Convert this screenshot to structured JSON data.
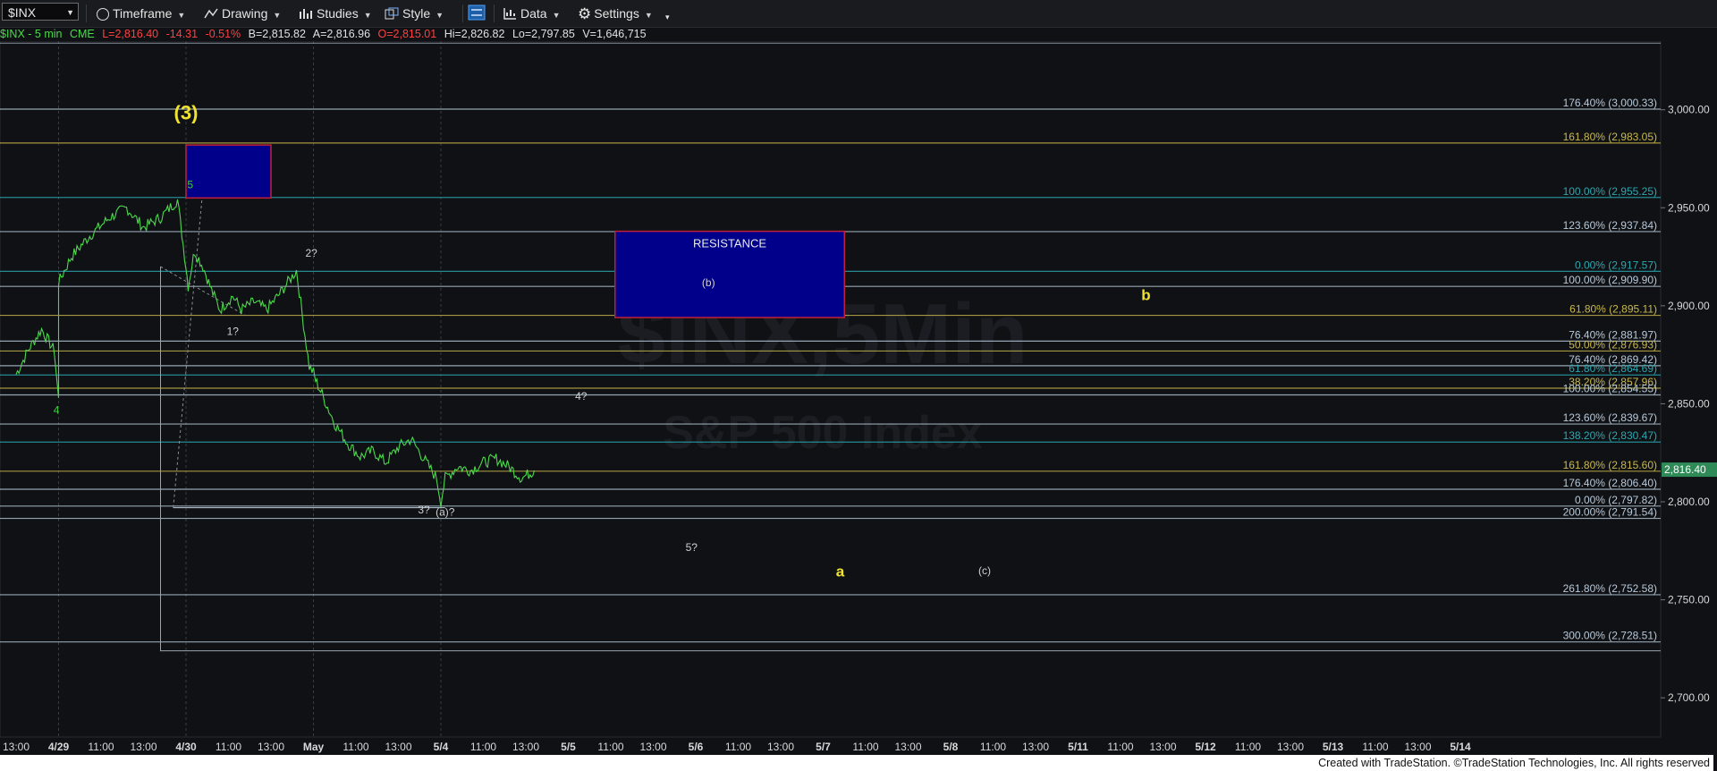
{
  "toolbar": {
    "symbol": "$INX",
    "timeframe_label": "Timeframe",
    "drawing_label": "Drawing",
    "studies_label": "Studies",
    "style_label": "Style",
    "data_label": "Data",
    "settings_label": "Settings"
  },
  "infobar": {
    "symbol_desc": "$INX - 5 min",
    "exchange": "CME",
    "last": "L=2,816.40",
    "change": "-14.31",
    "change_pct": "-0.51%",
    "bid": "B=2,815.82",
    "ask": "A=2,816.96",
    "open": "O=2,815.01",
    "high": "Hi=2,826.82",
    "low": "Lo=2,797.85",
    "volume": "V=1,646,715"
  },
  "colors": {
    "price_up": "#4cd84c",
    "price_down": "#ff3b3b",
    "info_text": "#e0e0e0",
    "wave_yellow": "#f0e330",
    "wave_green": "#3fcf3f",
    "grid": "#2a2c31",
    "box_fill": "#00008b",
    "box_border": "#c0203a",
    "current_price_bg": "#2e8b57"
  },
  "watermark": {
    "line1": "$INX,5Min",
    "line2": "S&P 500 Index"
  },
  "resistance_label": "RESISTANCE",
  "footer": "Created with TradeStation. ©TradeStation Technologies, Inc. All rights reserved",
  "current_price": "2,816.40",
  "chart_data": {
    "type": "line",
    "title": "$INX - 5 min",
    "ylim": [
      2680,
      3035
    ],
    "y_ticks": [
      "3,000.00",
      "2,950.00",
      "2,900.00",
      "2,850.00",
      "2,800.00",
      "2,750.00",
      "2,700.00"
    ],
    "y_tick_values": [
      3000,
      2950,
      2900,
      2850,
      2800,
      2750,
      2700
    ],
    "x_ticks": [
      {
        "label": "13:00",
        "idx": 0
      },
      {
        "label": "4/29",
        "idx": 1
      },
      {
        "label": "11:00",
        "idx": 2
      },
      {
        "label": "13:00",
        "idx": 3
      },
      {
        "label": "4/30",
        "idx": 4
      },
      {
        "label": "11:00",
        "idx": 5
      },
      {
        "label": "13:00",
        "idx": 6
      },
      {
        "label": "May",
        "idx": 7
      },
      {
        "label": "11:00",
        "idx": 8
      },
      {
        "label": "13:00",
        "idx": 9
      },
      {
        "label": "5/4",
        "idx": 10
      },
      {
        "label": "11:00",
        "idx": 11
      },
      {
        "label": "13:00",
        "idx": 12
      },
      {
        "label": "5/5",
        "idx": 13
      },
      {
        "label": "11:00",
        "idx": 14
      },
      {
        "label": "13:00",
        "idx": 15
      },
      {
        "label": "5/6",
        "idx": 16
      },
      {
        "label": "11:00",
        "idx": 17
      },
      {
        "label": "13:00",
        "idx": 18
      },
      {
        "label": "5/7",
        "idx": 19
      },
      {
        "label": "11:00",
        "idx": 20
      },
      {
        "label": "13:00",
        "idx": 21
      },
      {
        "label": "5/8",
        "idx": 22
      },
      {
        "label": "11:00",
        "idx": 23
      },
      {
        "label": "13:00",
        "idx": 24
      },
      {
        "label": "5/11",
        "idx": 25
      },
      {
        "label": "11:00",
        "idx": 26
      },
      {
        "label": "13:00",
        "idx": 27
      },
      {
        "label": "5/12",
        "idx": 28
      },
      {
        "label": "11:00",
        "idx": 29
      },
      {
        "label": "13:00",
        "idx": 30
      },
      {
        "label": "5/13",
        "idx": 31
      },
      {
        "label": "11:00",
        "idx": 32
      },
      {
        "label": "13:00",
        "idx": 33
      },
      {
        "label": "5/14",
        "idx": 34
      }
    ],
    "price_series": {
      "name": "$INX",
      "x": [
        0,
        0.3,
        0.6,
        0.9,
        1.0,
        1.0,
        1.3,
        1.7,
        2.2,
        2.6,
        3.0,
        3.4,
        3.8,
        4.0,
        4.05,
        4.2,
        4.4,
        4.6,
        4.8,
        5.1,
        5.3,
        5.6,
        5.9,
        6.2,
        6.6,
        6.9,
        7.0,
        7.05,
        7.2,
        7.5,
        7.8,
        8.1,
        8.4,
        8.7,
        9.0,
        9.3,
        9.6,
        9.9,
        10.0,
        10.1,
        10.4,
        10.7,
        11.0,
        11.3,
        11.6,
        11.9,
        12.2
      ],
      "y": [
        2865,
        2878,
        2888,
        2877,
        2852,
        2912,
        2925,
        2935,
        2945,
        2950,
        2940,
        2945,
        2954,
        2920,
        2910,
        2928,
        2920,
        2908,
        2898,
        2905,
        2898,
        2902,
        2898,
        2906,
        2918,
        2869,
        2866,
        2862,
        2855,
        2840,
        2830,
        2823,
        2826,
        2820,
        2828,
        2832,
        2822,
        2812,
        2800,
        2812,
        2818,
        2816,
        2820,
        2822,
        2818,
        2812,
        2816
      ]
    },
    "fib_levels": [
      {
        "label": "176.40% (3,000.33)",
        "value": 3000.33,
        "color": "#b7c9d9"
      },
      {
        "label": "161.80% (2,983.05)",
        "value": 2983.05,
        "color": "#c9b84a"
      },
      {
        "label": "100.00% (2,955.25)",
        "value": 2955.25,
        "color": "#2aa8b0"
      },
      {
        "label": "123.60% (2,937.84)",
        "value": 2937.84,
        "color": "#b7c9d9"
      },
      {
        "label": "0.00% (2,917.57)",
        "value": 2917.57,
        "color": "#2aa8b0"
      },
      {
        "label": "100.00% (2,909.90)",
        "value": 2909.9,
        "color": "#b7c9d9"
      },
      {
        "label": "61.80% (2,895.11)",
        "value": 2895.11,
        "color": "#c9b84a"
      },
      {
        "label": "76.40% (2,881.97)",
        "value": 2881.97,
        "color": "#b7c9d9"
      },
      {
        "label": "50.00% (2,876.93)",
        "value": 2876.93,
        "color": "#c9b84a"
      },
      {
        "label": "76.40% (2,869.42)",
        "value": 2869.42,
        "color": "#b7c9d9"
      },
      {
        "label": "61.80% (2,864.69)",
        "value": 2864.69,
        "color": "#2aa8b0"
      },
      {
        "label": "38.20% (2,857.96)",
        "value": 2857.96,
        "color": "#c9b84a"
      },
      {
        "label": "100.00% (2,854.55)",
        "value": 2854.55,
        "color": "#b7c9d9"
      },
      {
        "label": "123.60% (2,839.67)",
        "value": 2839.67,
        "color": "#b7c9d9"
      },
      {
        "label": "138.20% (2,830.47)",
        "value": 2830.47,
        "color": "#2aa8b0"
      },
      {
        "label": "161.80% (2,815.60)",
        "value": 2815.6,
        "color": "#c9b84a"
      },
      {
        "label": "176.40% (2,806.40)",
        "value": 2806.4,
        "color": "#b7c9d9"
      },
      {
        "label": "0.00% (2,797.82)",
        "value": 2797.82,
        "color": "#b7c9d9"
      },
      {
        "label": "200.00% (2,791.54)",
        "value": 2791.54,
        "color": "#b7c9d9"
      },
      {
        "label": "261.80% (2,752.58)",
        "value": 2752.58,
        "color": "#b7c9d9"
      },
      {
        "label": "300.00% (2,728.51)",
        "value": 2728.51,
        "color": "#b7c9d9"
      }
    ],
    "annotations": [
      {
        "text": "(3)",
        "x": 4.0,
        "y": 2995,
        "color": "#f0e330",
        "size": "large"
      },
      {
        "text": "5",
        "x": 4.1,
        "y": 2960,
        "color": "#3fcf3f",
        "size": "small"
      },
      {
        "text": "4",
        "x": 0.95,
        "y": 2845,
        "color": "#3fcf3f",
        "size": "small"
      },
      {
        "text": "2?",
        "x": 6.95,
        "y": 2925,
        "color": "#d0d0d0",
        "size": "small"
      },
      {
        "text": "1?",
        "x": 5.1,
        "y": 2885,
        "color": "#d0d0d0",
        "size": "small"
      },
      {
        "text": "3?",
        "x": 9.6,
        "y": 2794,
        "color": "#d0d0d0",
        "size": "small"
      },
      {
        "text": "(a)?",
        "x": 10.1,
        "y": 2793,
        "color": "#d0d0d0",
        "size": "small"
      },
      {
        "text": "(b)",
        "x": 16.3,
        "y": 2910,
        "color": "#d0d0d0",
        "size": "small"
      },
      {
        "text": "4?",
        "x": 13.3,
        "y": 2852,
        "color": "#d0d0d0",
        "size": "small"
      },
      {
        "text": "5?",
        "x": 15.9,
        "y": 2775,
        "color": "#d0d0d0",
        "size": "small"
      },
      {
        "text": "a",
        "x": 19.4,
        "y": 2762,
        "color": "#f0e330",
        "size": "medium"
      },
      {
        "text": "(c)",
        "x": 22.8,
        "y": 2763,
        "color": "#d0d0d0",
        "size": "small"
      },
      {
        "text": "b",
        "x": 26.6,
        "y": 2903,
        "color": "#f0e330",
        "size": "medium"
      }
    ],
    "boxes": [
      {
        "name": "wave-3-target-box",
        "x0": 4.0,
        "x1": 6.0,
        "y0": 2982,
        "y1": 2955
      },
      {
        "name": "resistance-box",
        "x0": 14.1,
        "x1": 19.5,
        "y0": 2938,
        "y1": 2894
      }
    ]
  }
}
